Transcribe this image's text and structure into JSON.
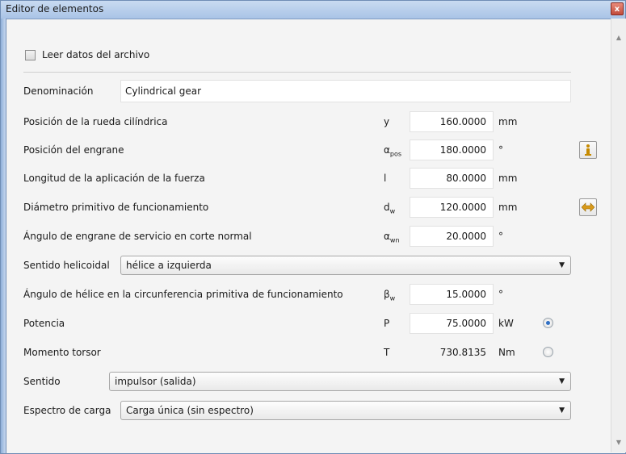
{
  "window": {
    "title": "Editor de elementos",
    "close_glyph": "x"
  },
  "read_file": {
    "label": "Leer datos del archivo",
    "checked": false
  },
  "denominacion": {
    "label": "Denominación",
    "value": "Cylindrical gear"
  },
  "params": [
    {
      "label": "Posición de la rueda cilíndrica",
      "symbol": "y",
      "sub": "",
      "value": "160.0000",
      "unit": "mm"
    },
    {
      "label": "Posición del engrane",
      "symbol": "α",
      "sub": "pos",
      "value": "180.0000",
      "unit": "°"
    },
    {
      "label": "Longitud de la aplicación de la fuerza",
      "symbol": "l",
      "sub": "",
      "value": "80.0000",
      "unit": "mm"
    },
    {
      "label": "Diámetro primitivo de funcionamiento",
      "symbol": "d",
      "sub": "w",
      "value": "120.0000",
      "unit": "mm"
    },
    {
      "label": "Ángulo de engrane de servicio en corte normal",
      "symbol": "α",
      "sub": "wn",
      "value": "20.0000",
      "unit": "°"
    }
  ],
  "helix_direction": {
    "label": "Sentido helicoidal",
    "selected": "hélice a izquierda"
  },
  "helix_angle": {
    "label": "Ángulo de hélice en la circunferencia primitiva de funcionamiento",
    "symbol": "β",
    "sub": "w",
    "value": "15.0000",
    "unit": "°"
  },
  "power": {
    "label": "Potencia",
    "symbol": "P",
    "value": "75.0000",
    "unit": "kW",
    "selected": true
  },
  "torque": {
    "label": "Momento torsor",
    "symbol": "T",
    "value": "730.8135",
    "unit": "Nm",
    "selected": false
  },
  "sentido": {
    "label": "Sentido",
    "selected": "impulsor (salida)"
  },
  "load_spectrum": {
    "label": "Espectro de carga",
    "selected": "Carga única (sin espectro)"
  },
  "icons": {
    "info": "info-icon",
    "swap": "swap-arrows-icon",
    "combo_arrow": "▼"
  }
}
